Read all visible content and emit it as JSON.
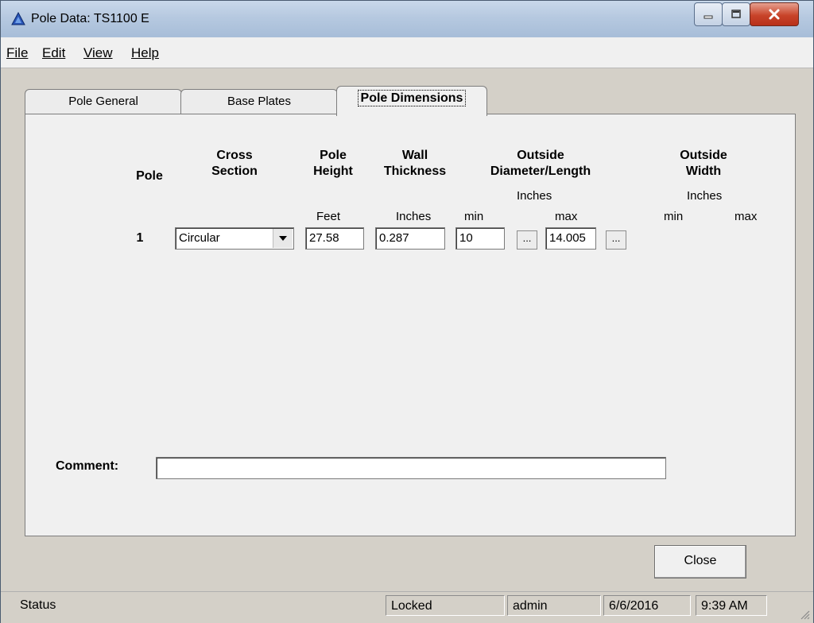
{
  "window": {
    "title": "Pole Data: TS1100 E"
  },
  "menu": [
    "File",
    "Edit",
    "View",
    "Help"
  ],
  "tabs": [
    {
      "label": "Pole General"
    },
    {
      "label": "Base Plates"
    },
    {
      "label": "Pole Dimensions"
    }
  ],
  "panel": {
    "headers": {
      "pole": "Pole",
      "cross_section": [
        "Cross",
        "Section"
      ],
      "pole_height": [
        "Pole",
        "Height"
      ],
      "wall_thickness": [
        "Wall",
        "Thickness"
      ],
      "outside_diameter": [
        "Outside",
        "Diameter/Length"
      ],
      "outside_width": [
        "Outside",
        "Width"
      ]
    },
    "units": {
      "od_inches": "Inches",
      "ow_inches": "Inches",
      "feet": "Feet",
      "wall_inches": "Inches",
      "od_min": "min",
      "od_max": "max",
      "ow_min": "min",
      "ow_max": "max"
    },
    "row": {
      "pole_number": "1",
      "cross_section": "Circular",
      "height": "27.58",
      "thickness": "0.287",
      "od_min": "10",
      "od_max": "14.005",
      "dots": "..."
    },
    "comment_label": "Comment:",
    "comment_value": ""
  },
  "buttons": {
    "close": "Close"
  },
  "status": {
    "status": "Status",
    "locked": "Locked",
    "user": "admin",
    "date": "6/6/2016",
    "time": "9:39 AM"
  }
}
